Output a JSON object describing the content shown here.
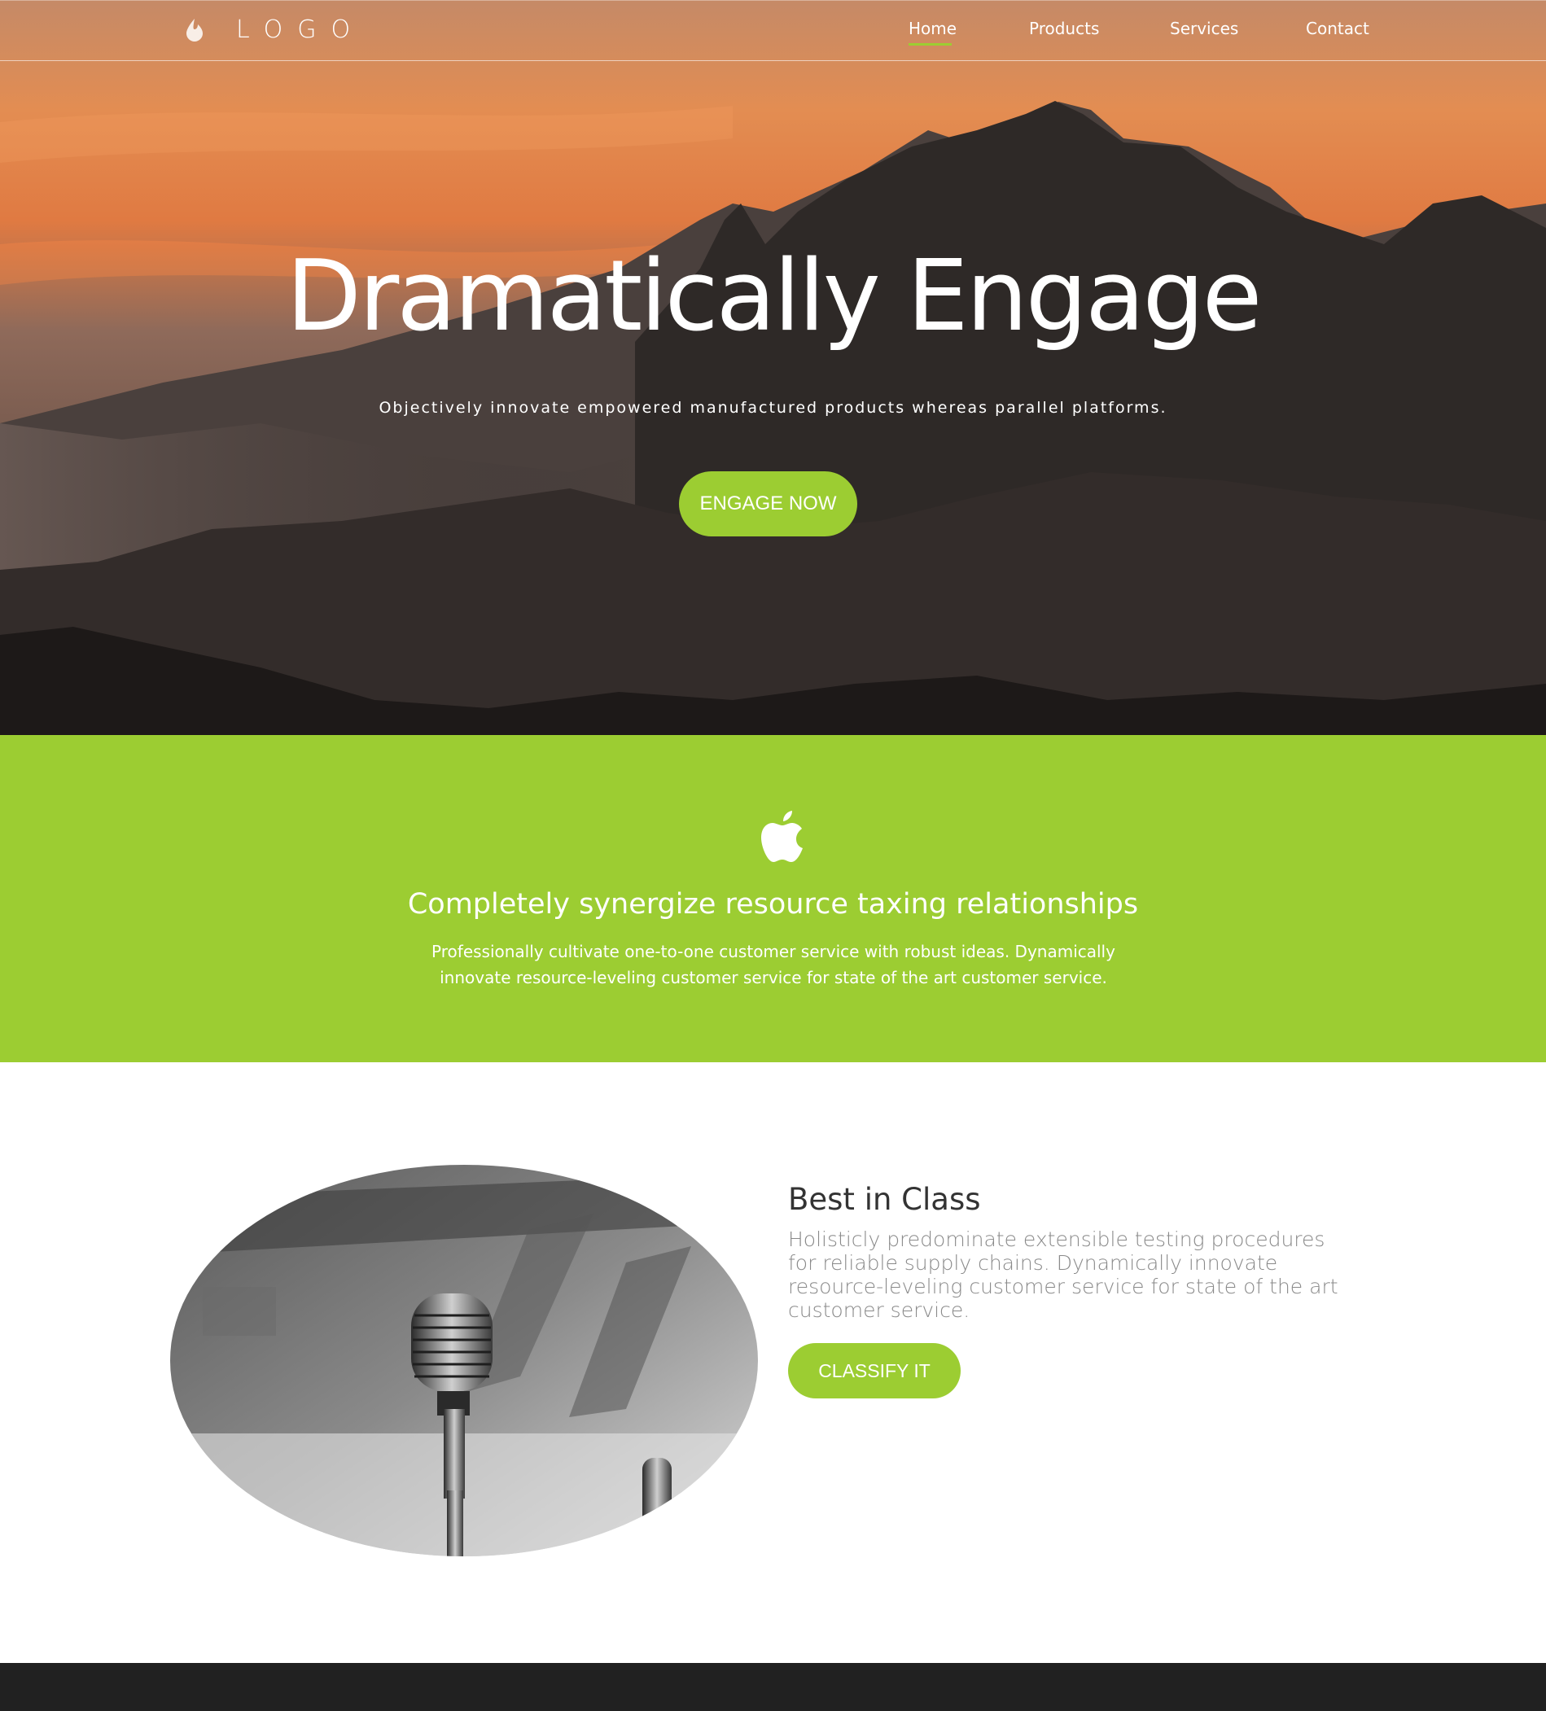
{
  "nav": {
    "logo_text": "LOGO",
    "items": [
      {
        "label": "Home",
        "active": true
      },
      {
        "label": "Products",
        "active": false
      },
      {
        "label": "Services",
        "active": false
      },
      {
        "label": "Contact",
        "active": false
      }
    ]
  },
  "hero": {
    "title": "Dramatically Engage",
    "subtitle": "Objectively innovate empowered manufactured products whereas parallel platforms.",
    "button_label": "ENGAGE NOW"
  },
  "intro": {
    "icon": "apple-icon",
    "title": "Completely synergize resource taxing relationships",
    "text": "Professionally cultivate one-to-one customer service with robust ideas. Dynamically innovate resource-leveling customer service for state of the art customer service."
  },
  "feature": {
    "image": "microphone-image",
    "title": "Best in Class",
    "text": "Holisticly predominate extensible testing procedures for reliable supply chains. Dynamically innovate resource-leveling customer service for state of the art customer service.",
    "button_label": "CLASSIFY IT"
  },
  "colors": {
    "accent": "#9ccd32",
    "footer": "#212121"
  }
}
